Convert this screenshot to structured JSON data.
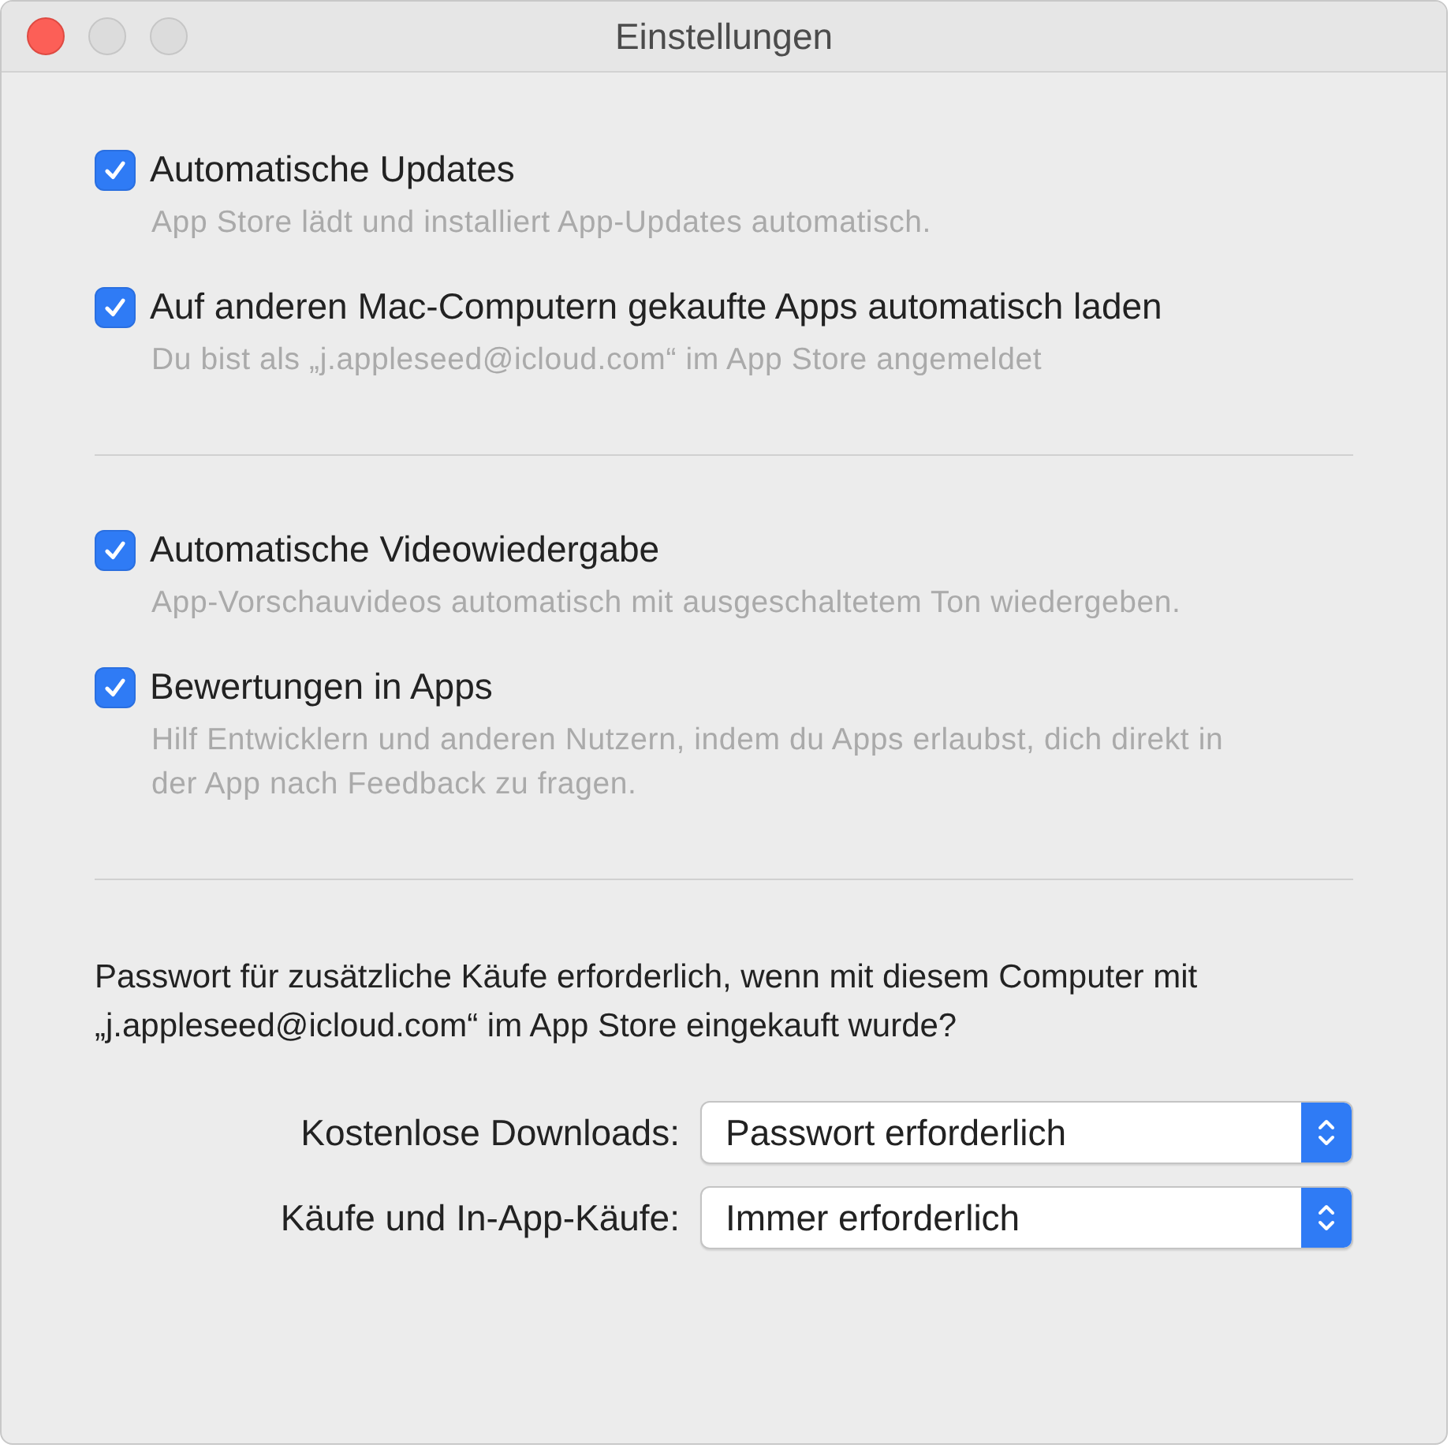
{
  "window": {
    "title": "Einstellungen"
  },
  "sections": [
    {
      "options": [
        {
          "label": "Automatische Updates",
          "description": "App Store lädt und installiert App-Updates automatisch.",
          "checked": true
        },
        {
          "label": "Auf anderen Mac-Computern gekaufte Apps automatisch laden",
          "description": "Du bist als „j.appleseed@icloud.com“ im App Store angemeldet",
          "checked": true
        }
      ]
    },
    {
      "options": [
        {
          "label": "Automatische Videowiedergabe",
          "description": "App-Vorschauvideos automatisch mit ausgeschaltetem Ton wiedergeben.",
          "checked": true
        },
        {
          "label": "Bewertungen in Apps",
          "description": "Hilf Entwicklern und anderen Nutzern, indem du Apps erlaubst, dich direkt in der App nach Feedback zu fragen.",
          "checked": true
        }
      ]
    }
  ],
  "password_question": "Passwort für zusätzliche Käufe erforderlich, wenn mit diesem Computer mit „j.appleseed@icloud.com“ im App Store eingekauft wurde?",
  "popups": [
    {
      "label": "Kostenlose Downloads:",
      "value": "Passwort erforderlich"
    },
    {
      "label": "Käufe und In-App-Käufe:",
      "value": "Immer erforderlich"
    }
  ]
}
